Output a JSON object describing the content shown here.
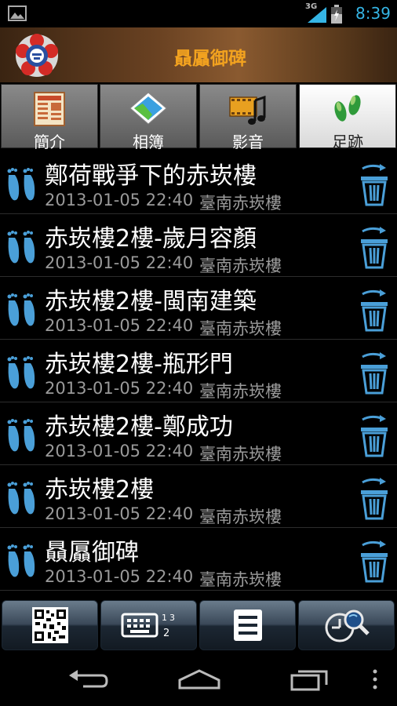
{
  "status": {
    "network": "3G",
    "time": "8:39"
  },
  "app": {
    "title": "贔屭御碑"
  },
  "tabs": [
    {
      "label": "簡介",
      "icon": "newspaper-icon"
    },
    {
      "label": "相簿",
      "icon": "photo-icon"
    },
    {
      "label": "影音",
      "icon": "film-music-icon"
    },
    {
      "label": "足跡",
      "icon": "footprints-icon",
      "active": true
    }
  ],
  "list": [
    {
      "title": "鄭荷戰爭下的赤崁樓",
      "date": "2013-01-05 22:40",
      "place": "臺南赤崁樓"
    },
    {
      "title": "赤崁樓2樓-歲月容顏",
      "date": "2013-01-05 22:40",
      "place": "臺南赤崁樓"
    },
    {
      "title": "赤崁樓2樓-閩南建築",
      "date": "2013-01-05 22:40",
      "place": "臺南赤崁樓"
    },
    {
      "title": "赤崁樓2樓-瓶形門",
      "date": "2013-01-05 22:40",
      "place": "臺南赤崁樓"
    },
    {
      "title": "赤崁樓2樓-鄭成功",
      "date": "2013-01-05 22:40",
      "place": "臺南赤崁樓"
    },
    {
      "title": "赤崁樓2樓",
      "date": "2013-01-05 22:40",
      "place": "臺南赤崁樓"
    },
    {
      "title": "贔屭御碑",
      "date": "2013-01-05 22:40",
      "place": "臺南赤崁樓"
    }
  ],
  "bottom": [
    "qr-code-icon",
    "keypad-icon",
    "list-icon",
    "clock-search-icon"
  ],
  "colors": {
    "accent": "#35b5e5",
    "title": "#f2a21f",
    "icon_blue": "#4a9fd8"
  }
}
